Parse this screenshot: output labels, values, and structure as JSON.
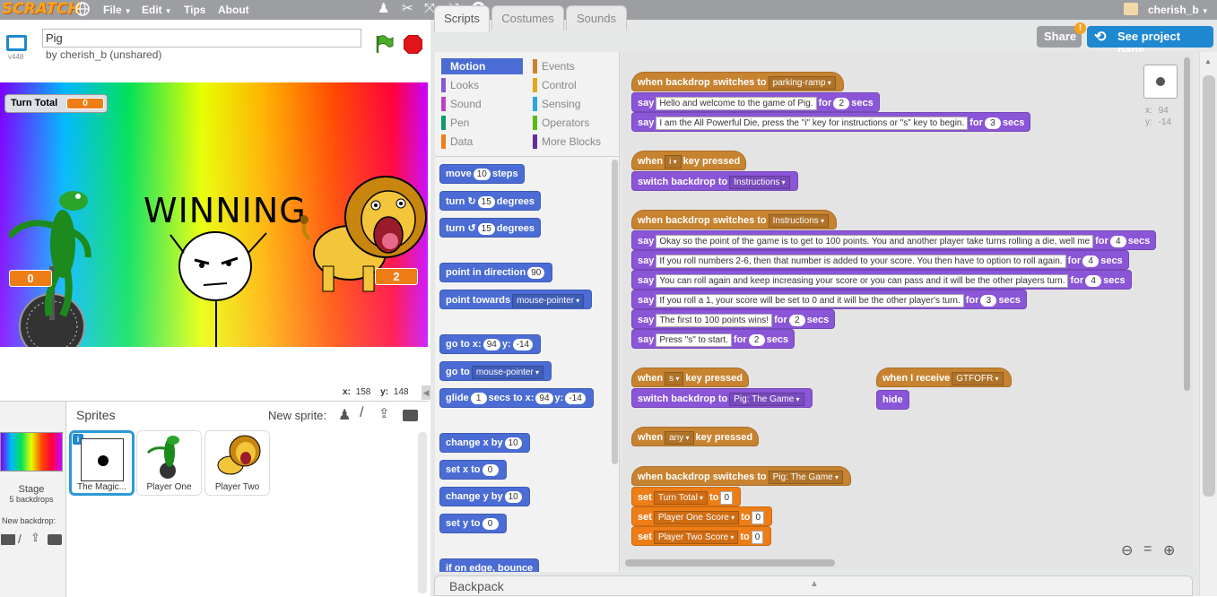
{
  "topbar": {
    "logo": "SCRATCH",
    "menu": [
      "File",
      "Edit",
      "Tips",
      "About"
    ],
    "username": "cherish_b",
    "icons": [
      "globe-icon",
      "duplicate-stamp-icon",
      "cut-icon",
      "grow-icon",
      "shrink-icon",
      "help-icon"
    ]
  },
  "project": {
    "title_value": "Pig",
    "author": "by cherish_b (unshared)",
    "version": "v448"
  },
  "stage": {
    "monitor_label": "Turn Total",
    "monitor_value": "0",
    "winning_text": "WINNING",
    "player_one_score": "0",
    "player_two_score": "2",
    "mouse_x_label": "x:",
    "mouse_x": "158",
    "mouse_y_label": "y:",
    "mouse_y": "148"
  },
  "sprites": {
    "header": "Sprites",
    "new_sprite_label": "New sprite:",
    "stage_label": "Stage",
    "stage_backdrops": "5 backdrops",
    "new_backdrop_label": "New backdrop:",
    "items": [
      {
        "name": "The Magic..."
      },
      {
        "name": "Player One"
      },
      {
        "name": "Player Two"
      }
    ]
  },
  "tabs": [
    "Scripts",
    "Costumes",
    "Sounds"
  ],
  "share_button": "Share",
  "see_project_button": "See project page",
  "categories": {
    "left": [
      "Motion",
      "Looks",
      "Sound",
      "Pen",
      "Data"
    ],
    "right": [
      "Events",
      "Control",
      "Sensing",
      "Operators",
      "More Blocks"
    ],
    "colors": {
      "Motion": "#4a6cd4",
      "Looks": "#8a55d7",
      "Sound": "#bb42c3",
      "Pen": "#0e9a6c",
      "Data": "#ee7d16",
      "Events": "#c88330",
      "Control": "#e1a91a",
      "Sensing": "#2ca5e2",
      "Operators": "#5cb712",
      "More Blocks": "#632d99"
    }
  },
  "palette": {
    "move": "move",
    "move_steps": "10",
    "steps": "steps",
    "turn": "turn",
    "turn_deg": "15",
    "degrees": "degrees",
    "point_in_direction": "point in direction",
    "direction": "90",
    "point_towards": "point towards",
    "towards_target": "mouse-pointer",
    "go_to_x": "go to x:",
    "go_x": "94",
    "y_label": "y:",
    "go_y": "-14",
    "go_to": "go to",
    "go_to_target": "mouse-pointer",
    "glide": "glide",
    "glide_secs": "1",
    "secs_to_x": "secs to x:",
    "glide_x": "94",
    "glide_y": "-14",
    "change_x_by": "change x by",
    "change_x": "10",
    "set_x_to": "set x to",
    "set_x": "0",
    "change_y_by": "change y by",
    "change_y": "10",
    "set_y_to": "set y to",
    "set_y": "0",
    "bounce": "if on edge, bounce"
  },
  "sprite_info": {
    "x_label": "x:",
    "x": "94",
    "y_label": "y:",
    "y": "-14"
  },
  "scripts": {
    "s1": {
      "hat": "when backdrop switches to",
      "backdrop": "parking-ramp",
      "say1": "Hello and welcome to the game of Pig.",
      "say1_secs": "2",
      "say2": "I am the All Powerful Die, press the \"i\" key for instructions or \"s\" key to begin.",
      "say2_secs": "3"
    },
    "s2": {
      "when": "when",
      "key": "i",
      "key_pressed": "key pressed",
      "switch": "switch backdrop to",
      "backdrop": "Instructions"
    },
    "s3": {
      "hat": "when backdrop switches to",
      "backdrop": "Instructions",
      "say1": "Okay so the point of the game is to get to 100 points. You and another player take turns rolling a die, well me",
      "say1_secs": "4",
      "say2": "If you roll numbers 2-6, then that number is added to your score. You then have to option to roll again.",
      "say2_secs": "4",
      "say3": "You can roll again and keep increasing your score or you can pass and it will be the other players turn.",
      "say3_secs": "4",
      "say4": "If you roll a 1, your score will be set to 0 and it will be the other player's turn.",
      "say4_secs": "3",
      "say5": "The first to 100 points wins!",
      "say5_secs": "2",
      "say6": "Press \"s\" to start.",
      "say6_secs": "2"
    },
    "s4": {
      "when": "when",
      "key": "s",
      "key_pressed": "key pressed",
      "switch": "switch backdrop to",
      "backdrop": "Pig: The Game"
    },
    "s5": {
      "hat": "when I receive",
      "message": "GTFOFR",
      "hide": "hide"
    },
    "s6": {
      "when": "when",
      "key": "any",
      "key_pressed": "key pressed"
    },
    "s7": {
      "hat": "when backdrop switches to",
      "backdrop": "Pig: The Game",
      "set": "set",
      "to": "to",
      "var1": "Turn Total",
      "val1": "0",
      "var2": "Player One Score",
      "val2": "0",
      "var3": "Player Two Score",
      "val3": "0"
    },
    "say": "say",
    "for": "for",
    "secs": "secs"
  },
  "backpack": "Backpack"
}
